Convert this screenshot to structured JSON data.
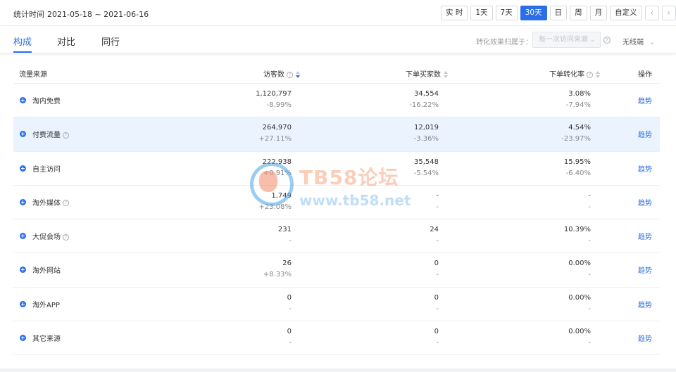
{
  "header": {
    "stat_label": "统计时间",
    "date_range": "2021-05-18 ~ 2021-06-16",
    "date_buttons": [
      "实 时",
      "1天",
      "7天",
      "30天",
      "日",
      "周",
      "月",
      "自定义"
    ],
    "active_date_button": "30天",
    "prev_icon": "chevron-left-icon",
    "next_icon": "chevron-right-icon"
  },
  "tabs": [
    "构成",
    "对比",
    "同行"
  ],
  "active_tab": "构成",
  "attribution": {
    "label": "转化效果归属于：",
    "value": "每一次访问来源",
    "help": "?"
  },
  "model": {
    "value": "无线端"
  },
  "table": {
    "columns": {
      "source": "流量来源",
      "visitors": "访客数",
      "buyers": "下单买家数",
      "rate": "下单转化率",
      "action": "操作"
    },
    "rows": [
      {
        "name": "淘内免费",
        "help": false,
        "visitors": "1,120,797",
        "visitors_change": "-8.99%",
        "buyers": "34,554",
        "buyers_change": "-16.22%",
        "rate": "3.08%",
        "rate_change": "-7.94%",
        "action": "趋势"
      },
      {
        "name": "付费流量",
        "help": true,
        "visitors": "264,970",
        "visitors_change": "+27.11%",
        "buyers": "12,019",
        "buyers_change": "-3.36%",
        "rate": "4.54%",
        "rate_change": "-23.97%",
        "action": "趋势"
      },
      {
        "name": "自主访问",
        "help": false,
        "visitors": "222,938",
        "visitors_change": "+0.91%",
        "buyers": "35,548",
        "buyers_change": "-5.54%",
        "rate": "15.95%",
        "rate_change": "-6.40%",
        "action": "趋势"
      },
      {
        "name": "淘外媒体",
        "help": true,
        "visitors": "1,749",
        "visitors_change": "+23.08%",
        "buyers": "-",
        "buyers_change": "-",
        "rate": "-",
        "rate_change": "-",
        "action": "趋势"
      },
      {
        "name": "大促会场",
        "help": true,
        "visitors": "231",
        "visitors_change": "-",
        "buyers": "24",
        "buyers_change": "-",
        "rate": "10.39%",
        "rate_change": "-",
        "action": "趋势"
      },
      {
        "name": "淘外网站",
        "help": false,
        "visitors": "26",
        "visitors_change": "+8.33%",
        "buyers": "0",
        "buyers_change": "-",
        "rate": "0.00%",
        "rate_change": "-",
        "action": "趋势"
      },
      {
        "name": "淘外APP",
        "help": false,
        "visitors": "0",
        "visitors_change": "-",
        "buyers": "0",
        "buyers_change": "-",
        "rate": "0.00%",
        "rate_change": "-",
        "action": "趋势"
      },
      {
        "name": "其它来源",
        "help": false,
        "visitors": "0",
        "visitors_change": "-",
        "buyers": "0",
        "buyers_change": "-",
        "rate": "0.00%",
        "rate_change": "-",
        "action": "趋势"
      }
    ]
  },
  "watermark": {
    "title": "TB58论坛",
    "url": "www.tb58.net"
  },
  "colors": {
    "accent": "#2a6ee8",
    "row_highlight": "#ebf3ff"
  }
}
